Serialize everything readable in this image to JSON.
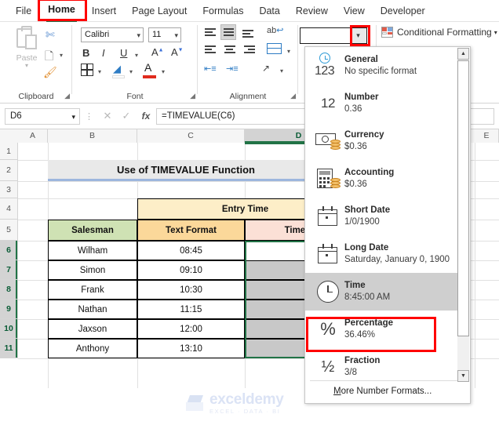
{
  "tabs": [
    {
      "label": "File"
    },
    {
      "label": "Home"
    },
    {
      "label": "Insert"
    },
    {
      "label": "Page Layout"
    },
    {
      "label": "Formulas"
    },
    {
      "label": "Data"
    },
    {
      "label": "Review"
    },
    {
      "label": "View"
    },
    {
      "label": "Developer"
    }
  ],
  "active_tab": "Home",
  "ribbon": {
    "clipboard": {
      "label": "Clipboard",
      "paste_label": "Paste",
      "cut_icon": "scissors-icon",
      "copy_icon": "copy-icon",
      "format_painter_icon": "format-painter-icon"
    },
    "font": {
      "label": "Font",
      "font_name": "Calibri",
      "font_size": "11",
      "bold": "B",
      "italic": "I",
      "underline": "U",
      "grow_font": "A",
      "shrink_font": "A"
    },
    "alignment": {
      "label": "Alignment",
      "wrap_text": "ab",
      "merge_label": "Merge & Center"
    },
    "number": {
      "format_value": "",
      "placeholder": ""
    },
    "styles": {
      "conditional_formatting": "Conditional Formatting"
    }
  },
  "formula_bar": {
    "name_box": "D6",
    "cancel_icon": "close-icon",
    "enter_icon": "check-icon",
    "function_icon": "fx",
    "formula": "=TIMEVALUE(C6)"
  },
  "grid": {
    "column_headers": [
      "A",
      "B",
      "C",
      "D",
      "E"
    ],
    "selected_column": "D",
    "row_headers": [
      "1",
      "2",
      "3",
      "4",
      "5",
      "6",
      "7",
      "8",
      "9",
      "10",
      "11"
    ],
    "selected_rows": [
      "6",
      "7",
      "8",
      "9",
      "10",
      "11"
    ],
    "title": "Use of TIMEVALUE Function",
    "group_header": "Entry Time",
    "headers": {
      "salesman": "Salesman",
      "text_format": "Text Format",
      "time_format": "Time F"
    },
    "rows": [
      {
        "row": "6",
        "salesman": "Wilham",
        "text_format": "08:45",
        "time_format": ""
      },
      {
        "row": "7",
        "salesman": "Simon",
        "text_format": "09:10",
        "time_format": ""
      },
      {
        "row": "8",
        "salesman": "Frank",
        "text_format": "10:30",
        "time_format": ""
      },
      {
        "row": "9",
        "salesman": "Nathan",
        "text_format": "11:15",
        "time_format": ""
      },
      {
        "row": "10",
        "salesman": "Jaxson",
        "text_format": "12:00",
        "time_format": ""
      },
      {
        "row": "11",
        "salesman": "Anthony",
        "text_format": "13:10",
        "time_format": ""
      }
    ]
  },
  "number_format_dropdown": {
    "open": true,
    "highlighted": "Time",
    "items": [
      {
        "name": "General",
        "sample": "No specific format",
        "icon": "general-123-icon"
      },
      {
        "name": "Number",
        "sample": "0.36",
        "icon": "number-12-icon"
      },
      {
        "name": "Currency",
        "sample": "$0.36",
        "icon": "currency-bill-icon"
      },
      {
        "name": "Accounting",
        "sample": " $0.36",
        "icon": "accounting-calculator-icon"
      },
      {
        "name": "Short Date",
        "sample": "1/0/1900",
        "icon": "calendar-icon"
      },
      {
        "name": "Long Date",
        "sample": "Saturday, January 0, 1900",
        "icon": "calendar-icon"
      },
      {
        "name": "Time",
        "sample": "8:45:00 AM",
        "icon": "clock-icon"
      },
      {
        "name": "Percentage",
        "sample": "36.46%",
        "icon": "percent-icon"
      },
      {
        "name": "Fraction",
        "sample": "3/8",
        "icon": "fraction-icon"
      }
    ],
    "more_formats": "More Number Formats...",
    "more_formats_accel": "M",
    "more_formats_rest": "ore Number Formats..."
  },
  "watermark": {
    "brand": "exceldemy",
    "tagline": "EXCEL · DATA · BI"
  },
  "colors": {
    "accent_green": "#217346",
    "annotation_red": "#ff0000",
    "header_green": "#cfe2b4",
    "header_orange": "#fbd89a",
    "header_peach": "#fbe0d6",
    "header_cream": "#fdeec8",
    "selection_gray": "#c8c8c8"
  }
}
